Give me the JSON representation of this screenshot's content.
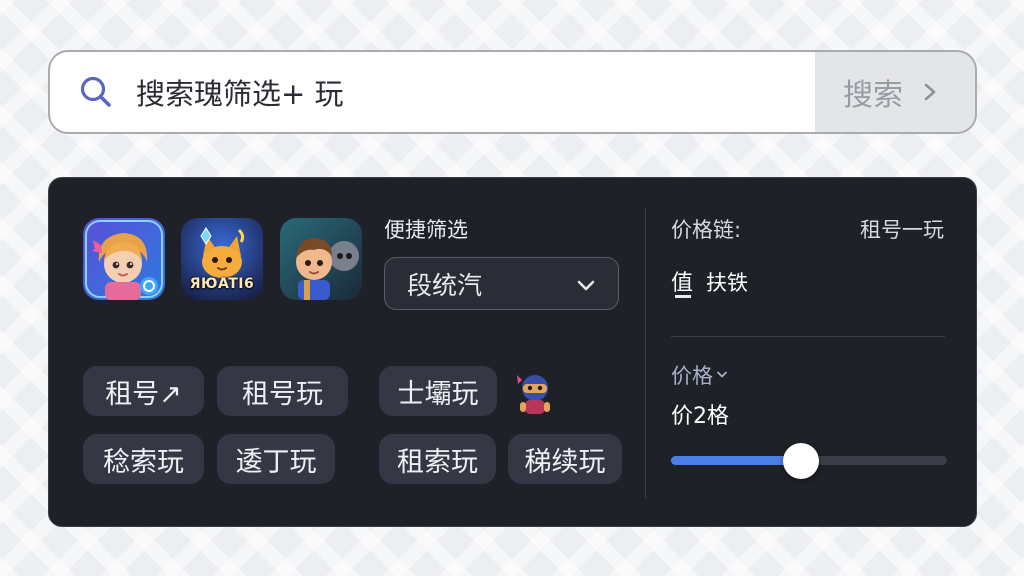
{
  "search": {
    "query": "搜索瑰筛选+ 玩",
    "submit_label": "搜索",
    "icons": {
      "search": "search-icon",
      "submit": "chevron-right-icon"
    }
  },
  "panel": {
    "game_icons": [
      {
        "name": "game-icon-girl",
        "caption": ""
      },
      {
        "name": "game-icon-fox",
        "caption": "ЯЮATI6"
      },
      {
        "name": "game-icon-hero",
        "caption": ""
      }
    ],
    "filter_title": "便捷筛选",
    "dropdown": {
      "selected": "段统汽",
      "icon": "chevron-down-icon"
    },
    "chips": [
      "租号↗",
      "租号玩",
      "士壩玩",
      "稔索玩",
      "逶丁玩",
      "租索玩",
      "稊续玩"
    ],
    "right": {
      "price_chain_label": "价格链:",
      "price_chain_value": "租号一玩",
      "value_label": "值",
      "value_text": "扶铁",
      "price_toggle": "价格",
      "price_value": "价2格",
      "slider_fraction": 0.47
    }
  },
  "colors": {
    "accent": "#4a80e8",
    "panel_bg": "#1f2129",
    "chip_bg": "#353844",
    "search_icon": "#5a66c4"
  }
}
